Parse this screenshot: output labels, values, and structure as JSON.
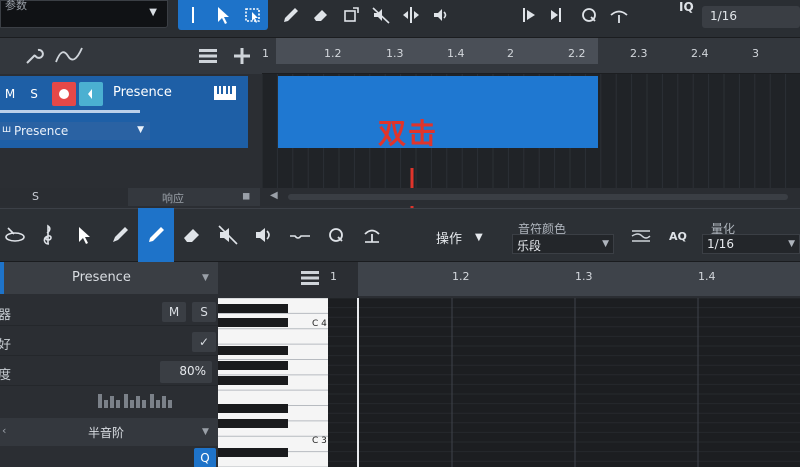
{
  "top_toolbar": {
    "track_dropdown": "参数",
    "iq_label": "IQ",
    "quantize_value": "1/16",
    "tool_icons": [
      "select-arrow-icon",
      "range-icon",
      "pencil-icon",
      "eraser-icon",
      "split-icon",
      "mute-icon",
      "bend-icon",
      "listen-icon",
      "quantize-icon"
    ]
  },
  "arrange": {
    "ruler_ticks": [
      "1",
      "1.2",
      "1.3",
      "1.4",
      "2",
      "2.2",
      "2.3",
      "2.4",
      "3"
    ],
    "track": {
      "mute": "M",
      "solo": "S",
      "name": "Presence",
      "instrument": "Presence"
    },
    "annotation": "双击",
    "lower_labels": [
      "S",
      "响应"
    ]
  },
  "editor_toolbar": {
    "action_label": "操作",
    "note_color_label": "音符颜色",
    "note_color_value": "乐段",
    "aq_label": "AQ",
    "quantize_label": "量化",
    "quantize_value": "1/16"
  },
  "editor_inspector": {
    "track_name": "Presence",
    "rows": [
      {
        "label": "器",
        "m": "M",
        "s": "S"
      },
      {
        "label": "好",
        "check": "✓"
      },
      {
        "label": "度",
        "value": "80%"
      }
    ],
    "scale_label": "半音阶",
    "q_button": "Q"
  },
  "editor_ruler": {
    "ticks": [
      "1",
      "1.2",
      "1.3",
      "1.4"
    ],
    "key_labels": [
      "C 4",
      "C 3"
    ]
  },
  "colors": {
    "accent_blue": "#1e73c9",
    "record_red": "#e54848",
    "annotation_red": "#e0342b"
  }
}
